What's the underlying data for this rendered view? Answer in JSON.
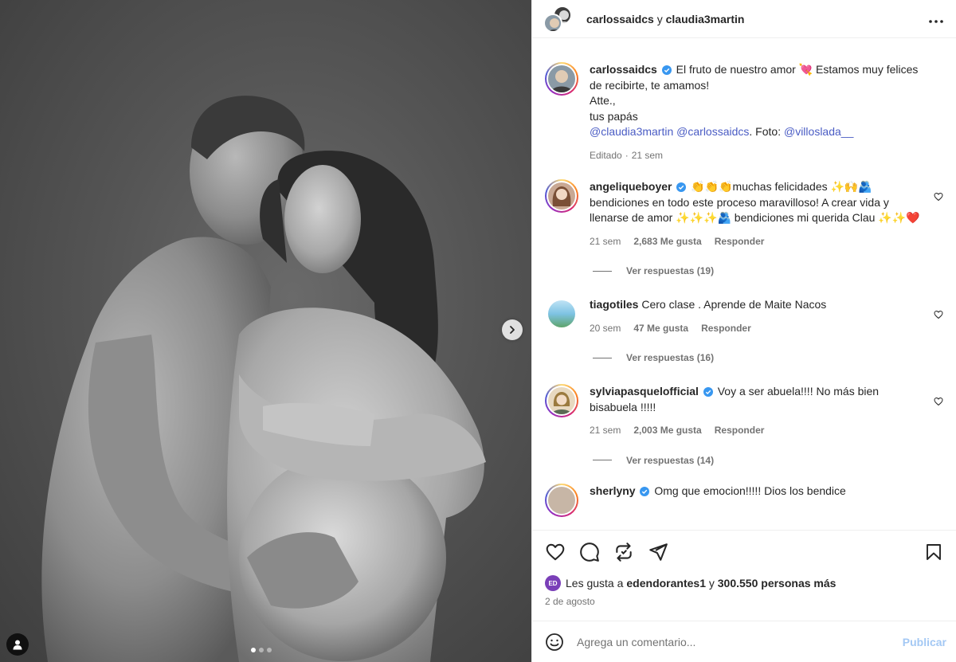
{
  "header": {
    "user1": "carlossaidcs",
    "connector": "y",
    "user2": "claudia3martin",
    "more_icon": "more-horizontal-icon"
  },
  "caption": {
    "username": "carlossaidcs",
    "line1": "El fruto de nuestro amor 💘 Estamos muy felices de recibirte, te amamos!",
    "line2": "Atte.,",
    "line3": "tus papás",
    "mention1": "@claudia3martin",
    "mention2": "@carlossaidcs",
    "foto_label": ". Foto: ",
    "mention3": "@villoslada__",
    "edited": "Editado",
    "time": "21 sem"
  },
  "comments": [
    {
      "username": "angeliqueboyer",
      "verified": true,
      "text": "👏👏👏muchas felicidades ✨🙌🫂 bendiciones en todo este proceso maravilloso! A crear vida y llenarse de amor ✨✨✨🫂 bendiciones mi querida Clau ✨✨❤️",
      "time": "21 sem",
      "likes": "2,683 Me gusta",
      "reply": "Responder",
      "view_replies": "Ver respuestas (19)"
    },
    {
      "username": "tiagotiles",
      "verified": false,
      "text": "Cero clase . Aprende de Maite Nacos",
      "time": "20 sem",
      "likes": "47 Me gusta",
      "reply": "Responder",
      "view_replies": "Ver respuestas (16)"
    },
    {
      "username": "sylviapasquelofficial",
      "verified": true,
      "text": "Voy a ser abuela!!!! No más bien bisabuela !!!!!",
      "time": "21 sem",
      "likes": "2,003 Me gusta",
      "reply": "Responder",
      "view_replies": "Ver respuestas (14)"
    },
    {
      "username": "sherlyny",
      "verified": true,
      "text": "Omg que emocion!!!!! Dios los bendice"
    }
  ],
  "actions": {
    "like_icon": "heart-icon",
    "comment_icon": "comment-icon",
    "share_icon": "share-icon",
    "repost_icon": "repost-icon",
    "save_icon": "bookmark-icon"
  },
  "likes": {
    "avatar_initials": "ED",
    "prefix": "Les gusta a ",
    "user": "edendorantes1",
    "middle": " y ",
    "count": "300.550 personas más"
  },
  "date": "2 de agosto",
  "add_comment": {
    "placeholder": "Agrega un comentario...",
    "publish": "Publicar",
    "emoji_icon": "smiley-icon"
  },
  "carousel": {
    "total": 3,
    "active": 1
  }
}
